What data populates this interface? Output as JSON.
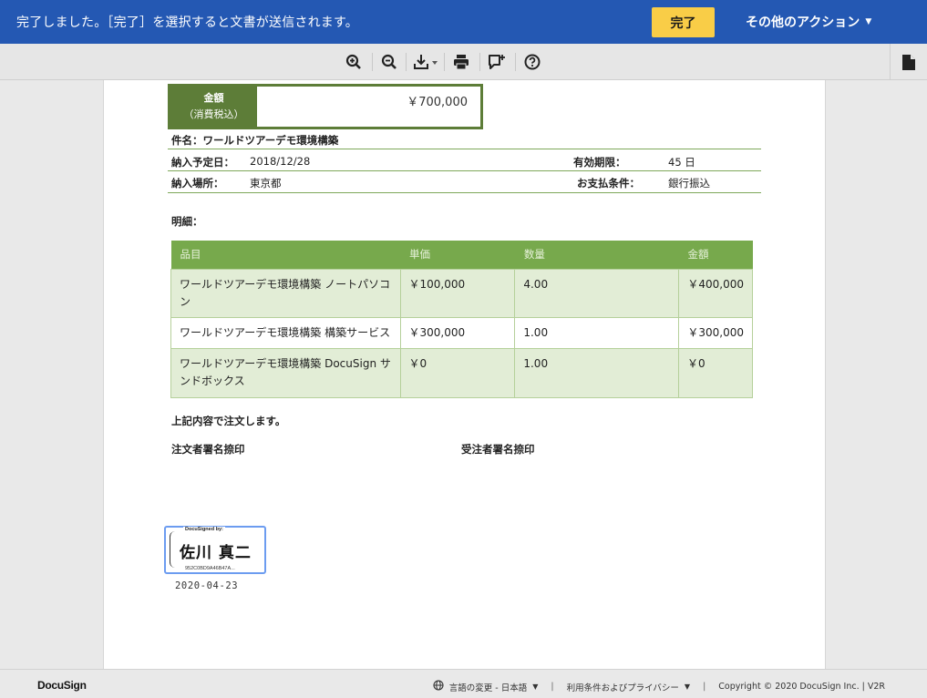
{
  "banner": {
    "message": "完了しました。［完了］を選択すると文書が送信されます。",
    "finish_label": "完了",
    "more_actions_label": "その他のアクション",
    "accent_color": "#2458b3",
    "finish_color": "#f9cd47"
  },
  "toolbar": {
    "icons": [
      "zoom-in-icon",
      "zoom-out-icon",
      "download-icon",
      "print-icon",
      "add-comment-icon",
      "help-icon"
    ],
    "side_icon": "document-icon"
  },
  "document": {
    "amount": {
      "label": "金額",
      "sublabel": "（消費税込）",
      "value": "￥700,000"
    },
    "subject": "件名：ワールドツアーデモ環境構築",
    "delivery_date_label": "納入予定日：",
    "delivery_date": "2018/12/28",
    "validity_label": "有効期限：",
    "validity": "45 日",
    "delivery_place_label": "納入場所：",
    "delivery_place": "東京都",
    "payment_label": "お支払条件：",
    "payment": "銀行振込",
    "details_title": "明細：",
    "table": {
      "headers": [
        "品目",
        "単価",
        "数量",
        "金額"
      ],
      "rows": [
        {
          "item": "ワールドツアーデモ環境構築 ノートパソコン",
          "unit_price": "￥100,000",
          "quantity": "4.00",
          "amount": "￥400,000"
        },
        {
          "item": "ワールドツアーデモ環境構築 構築サービス",
          "unit_price": "￥300,000",
          "quantity": "1.00",
          "amount": "￥300,000"
        },
        {
          "item": "ワールドツアーデモ環境構築 DocuSign サンドボックス",
          "unit_price": "￥0",
          "quantity": "1.00",
          "amount": "￥0"
        }
      ]
    },
    "order_note": "上記内容で注文します。",
    "orderer_sign_label": "注文者署名捺印",
    "receiver_sign_label": "受注者署名捺印",
    "signature": {
      "header": "DocuSigned by:",
      "name": "佐川 真二",
      "id": "952C0BD9A46B47A...",
      "date": "2020-04-23"
    },
    "theme_color": "#5d7d38"
  },
  "footer": {
    "brand": "DocuSign",
    "language": "言語の変更 - 日本語",
    "terms": "利用条件およびプライバシー",
    "copyright": "Copyright © 2020 DocuSign Inc. | V2R"
  }
}
